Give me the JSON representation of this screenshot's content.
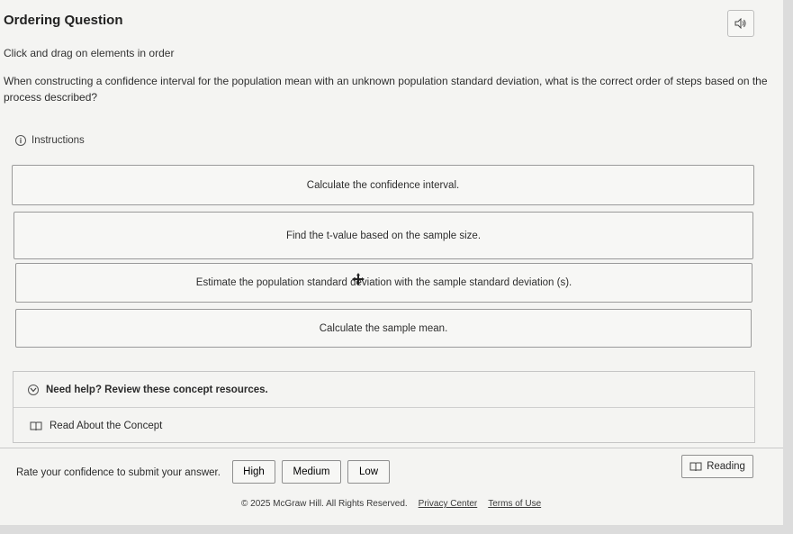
{
  "header": {
    "title": "Ordering Question",
    "audio_icon": "speaker-icon"
  },
  "subtitle": "Click and drag on elements in order",
  "question": "When constructing a confidence interval for the population mean with an unknown population standard deviation, what is the correct order of steps based on the process described?",
  "instructions": {
    "label": "Instructions",
    "icon": "info-icon"
  },
  "order_items": [
    "Calculate the confidence interval.",
    "Find the t-value based on the sample size.",
    "Estimate the population standard deviation with the sample standard deviation (s).",
    "Calculate the sample mean."
  ],
  "help": {
    "title": "Need help? Review these concept resources.",
    "resource": "Read About the Concept"
  },
  "confidence": {
    "label": "Rate your confidence to submit your answer.",
    "options": [
      "High",
      "Medium",
      "Low"
    ]
  },
  "reading_label": "Reading",
  "footer": {
    "copyright": "© 2025 McGraw Hill. All Rights Reserved.",
    "privacy": "Privacy Center",
    "terms": "Terms of Use"
  }
}
